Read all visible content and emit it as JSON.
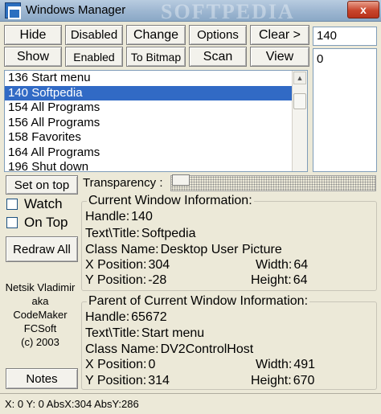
{
  "window": {
    "title": "Windows Manager",
    "watermark": "SOFTPEDIA",
    "close_glyph": "x"
  },
  "buttons_row1": [
    {
      "name": "hide-button",
      "label": "Hide"
    },
    {
      "name": "disabled-button",
      "label": "Disabled"
    },
    {
      "name": "change-button",
      "label": "Change"
    },
    {
      "name": "options-button",
      "label": "Options"
    },
    {
      "name": "clear-button",
      "label": "Clear >"
    }
  ],
  "buttons_row2": [
    {
      "name": "show-button",
      "label": "Show"
    },
    {
      "name": "enabled-button",
      "label": "Enabled"
    },
    {
      "name": "to-bitmap-button",
      "label": "To Bitmap"
    },
    {
      "name": "scan-button",
      "label": "Scan"
    },
    {
      "name": "view-button",
      "label": "View"
    }
  ],
  "handle_field": {
    "value": "140"
  },
  "value_list": {
    "value": "0"
  },
  "window_list": {
    "items": [
      {
        "label": "136 Start menu",
        "selected": false
      },
      {
        "label": "140 Softpedia",
        "selected": true
      },
      {
        "label": "154 All Programs",
        "selected": false
      },
      {
        "label": "156 All Programs",
        "selected": false
      },
      {
        "label": "158 Favorites",
        "selected": false
      },
      {
        "label": "164 All Programs",
        "selected": false
      },
      {
        "label": "196 Shut down",
        "selected": false
      }
    ]
  },
  "left_panel": {
    "set_on_top": "Set on top",
    "watch": "Watch",
    "on_top": "On Top",
    "redraw_all": "Redraw All",
    "credits": [
      "Netsik Vladimir",
      "aka",
      "CodeMaker",
      "FCSoft",
      "(c) 2003"
    ],
    "notes": "Notes"
  },
  "transparency": {
    "label": "Transparency :"
  },
  "current": {
    "title": "Current Window Information:",
    "handle_label": "Handle:",
    "handle": "140",
    "text_label": "Text\\Title:",
    "text": "Softpedia",
    "class_label": "Class Name:",
    "class": "Desktop User Picture",
    "x_label": "X Position:",
    "x": "304",
    "y_label": "Y Position:",
    "y": "-28",
    "w_label": "Width:",
    "w": "64",
    "h_label": "Height:",
    "h": "64"
  },
  "parent": {
    "title": "Parent of Current Window Information:",
    "handle_label": "Handle:",
    "handle": "65672",
    "text_label": "Text\\Title:",
    "text": "Start menu",
    "class_label": "Class Name:",
    "class": "DV2ControlHost",
    "x_label": "X Position:",
    "x": "0",
    "y_label": "Y Position:",
    "y": "314",
    "w_label": "Width:",
    "w": "491",
    "h_label": "Height:",
    "h": "670"
  },
  "status": {
    "text": "X:  0  Y:  0  AbsX:304  AbsY:286"
  }
}
